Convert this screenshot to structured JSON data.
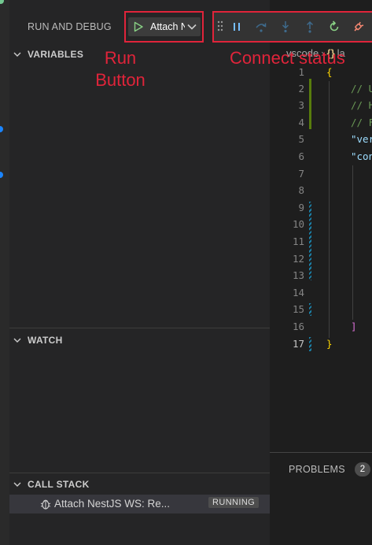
{
  "debug_view": {
    "title": "RUN AND DEBUG",
    "config_name": "Attach NestJS WS: Re..."
  },
  "sections": {
    "variables": "VARIABLES",
    "watch": "WATCH",
    "call_stack": "CALL STACK"
  },
  "call_stack": {
    "session_label": "Attach NestJS WS: Re...",
    "status": "RUNNING"
  },
  "toolbar": {
    "buttons": [
      "pause",
      "step-over",
      "step-into",
      "step-out",
      "restart",
      "disconnect"
    ]
  },
  "editor": {
    "breadcrumb": [
      "vscode",
      "la"
    ],
    "line_numbers": [
      "1",
      "2",
      "3",
      "4",
      "5",
      "6",
      "7",
      "8",
      "9",
      "10",
      "11",
      "12",
      "13",
      "14",
      "15",
      "16",
      "17"
    ],
    "active_line": "17",
    "code": {
      "l1": "{",
      "l2": "// U",
      "l3": "// H",
      "l4": "// F",
      "l5": "\"ver",
      "l6": "\"con",
      "l16": "]",
      "l17": "}"
    }
  },
  "panel": {
    "problems_label": "PROBLEMS",
    "problems_count": "2"
  },
  "annotations": {
    "run_button": [
      "Run",
      "Button"
    ],
    "connect_status": "Connect status"
  },
  "colors": {
    "annotation_red": "#e0243a",
    "play_green": "#89d185",
    "debug_blue": "#75beff"
  }
}
